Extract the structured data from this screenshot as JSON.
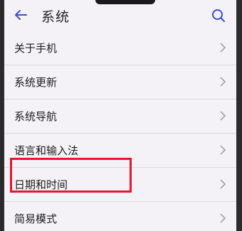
{
  "header": {
    "title": "系统",
    "back_icon": "back-arrow-icon",
    "search_icon": "search-icon"
  },
  "menu": {
    "items": [
      {
        "label": "关于手机"
      },
      {
        "label": "系统更新"
      },
      {
        "label": "系统导航"
      },
      {
        "label": "语言和输入法"
      },
      {
        "label": "日期和时间"
      },
      {
        "label": "简易模式"
      }
    ]
  },
  "colors": {
    "highlight": "#e5172a",
    "accent": "#3b4bd8",
    "background": "#f4f2f6"
  }
}
